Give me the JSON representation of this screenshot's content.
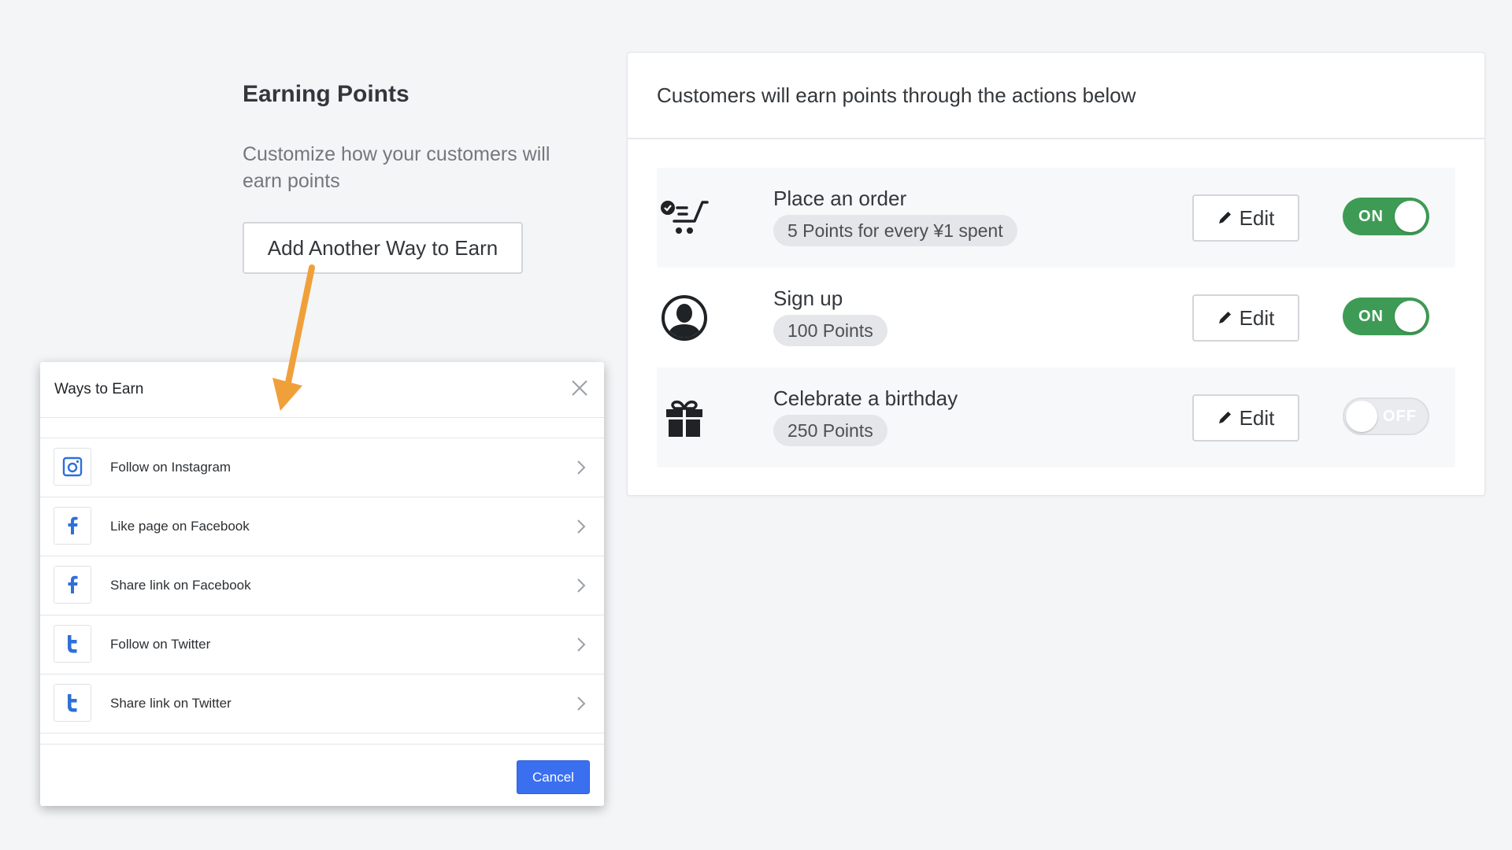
{
  "section": {
    "title": "Earning Points",
    "description": "Customize how your customers will earn points",
    "add_button": "Add Another Way to Earn"
  },
  "card": {
    "header": "Customers will earn points through the actions below",
    "rules": [
      {
        "icon": "cart-icon",
        "title": "Place an order",
        "points": "5 Points for every ¥1 spent",
        "edit": "Edit",
        "toggle": "ON",
        "enabled": true
      },
      {
        "icon": "user-icon",
        "title": "Sign up",
        "points": "100 Points",
        "edit": "Edit",
        "toggle": "ON",
        "enabled": true
      },
      {
        "icon": "gift-icon",
        "title": "Celebrate a birthday",
        "points": "250 Points",
        "edit": "Edit",
        "toggle": "OFF",
        "enabled": false
      }
    ]
  },
  "modal": {
    "title": "Ways to Earn",
    "items": [
      {
        "icon": "instagram-icon",
        "label": "Follow on Instagram"
      },
      {
        "icon": "facebook-icon",
        "label": "Like page on Facebook"
      },
      {
        "icon": "facebook-icon",
        "label": "Share link on Facebook"
      },
      {
        "icon": "twitter-icon",
        "label": "Follow on Twitter"
      },
      {
        "icon": "twitter-icon",
        "label": "Share link on Twitter"
      }
    ],
    "cancel": "Cancel"
  },
  "colors": {
    "toggle_on": "#3e9b55",
    "primary_button": "#3a6ff0",
    "annotation_arrow": "#f0a03a",
    "social_icon": "#2f6fd8"
  }
}
